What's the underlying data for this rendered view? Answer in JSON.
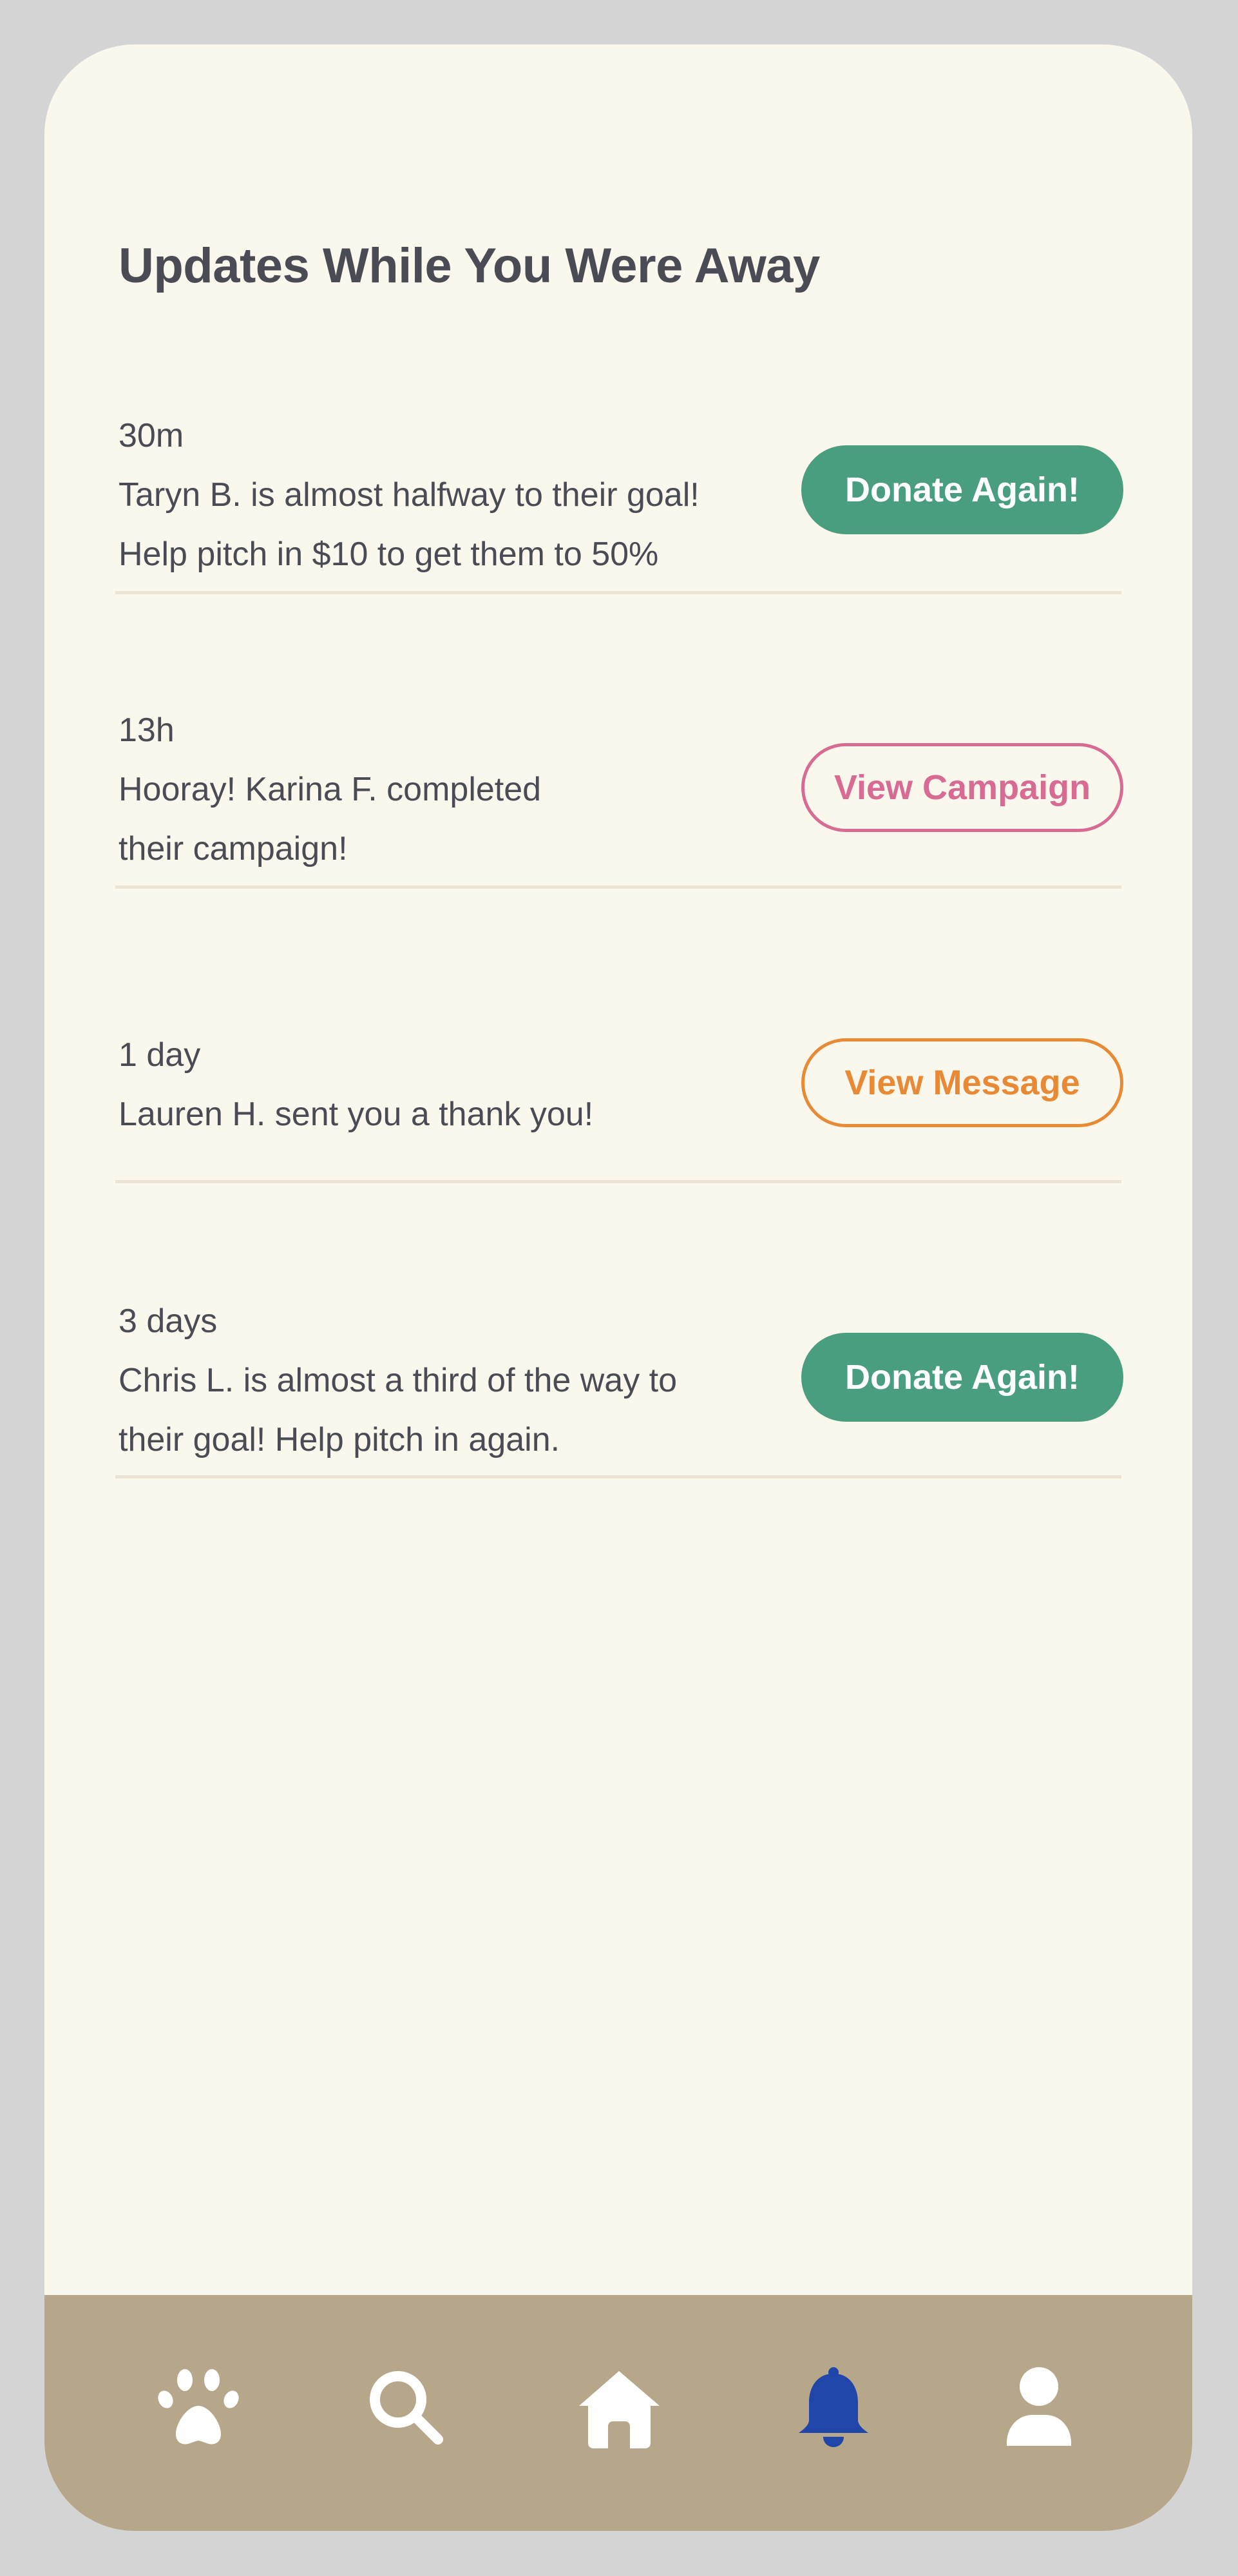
{
  "page": {
    "title": "Updates While You Were Away"
  },
  "updates": [
    {
      "time": "30m",
      "lines": [
        "Taryn B. is almost halfway to their goal!",
        "Help pitch in $10 to get them to 50%"
      ],
      "action_label": "Donate Again!",
      "action_style": "solid-green"
    },
    {
      "time": "13h",
      "lines": [
        "Hooray! Karina F. completed",
        "their campaign!"
      ],
      "action_label": "View Campaign",
      "action_style": "outline-pink"
    },
    {
      "time": "1 day",
      "lines": [
        "Lauren H. sent you a thank you!"
      ],
      "action_label": "View Message",
      "action_style": "outline-orange"
    },
    {
      "time": "3 days",
      "lines": [
        "Chris L. is almost a third of the way to",
        "their goal! Help pitch in again."
      ],
      "action_label": "Donate Again!",
      "action_style": "solid-green"
    }
  ],
  "nav": {
    "items": [
      {
        "icon": "paw-icon",
        "active": false
      },
      {
        "icon": "search-icon",
        "active": false
      },
      {
        "icon": "home-icon",
        "active": false
      },
      {
        "icon": "bell-icon",
        "active": true
      },
      {
        "icon": "profile-icon",
        "active": false
      }
    ]
  },
  "colors": {
    "background": "#faf7ec",
    "frame": "#d4d4d4",
    "text": "#4a4b55",
    "green": "#4a9e80",
    "pink": "#d86b93",
    "orange": "#e88a35",
    "nav_bar": "#b7a78a",
    "nav_icon": "#ffffff",
    "nav_icon_active": "#1f46a8",
    "divider": "#ebe3d3"
  }
}
